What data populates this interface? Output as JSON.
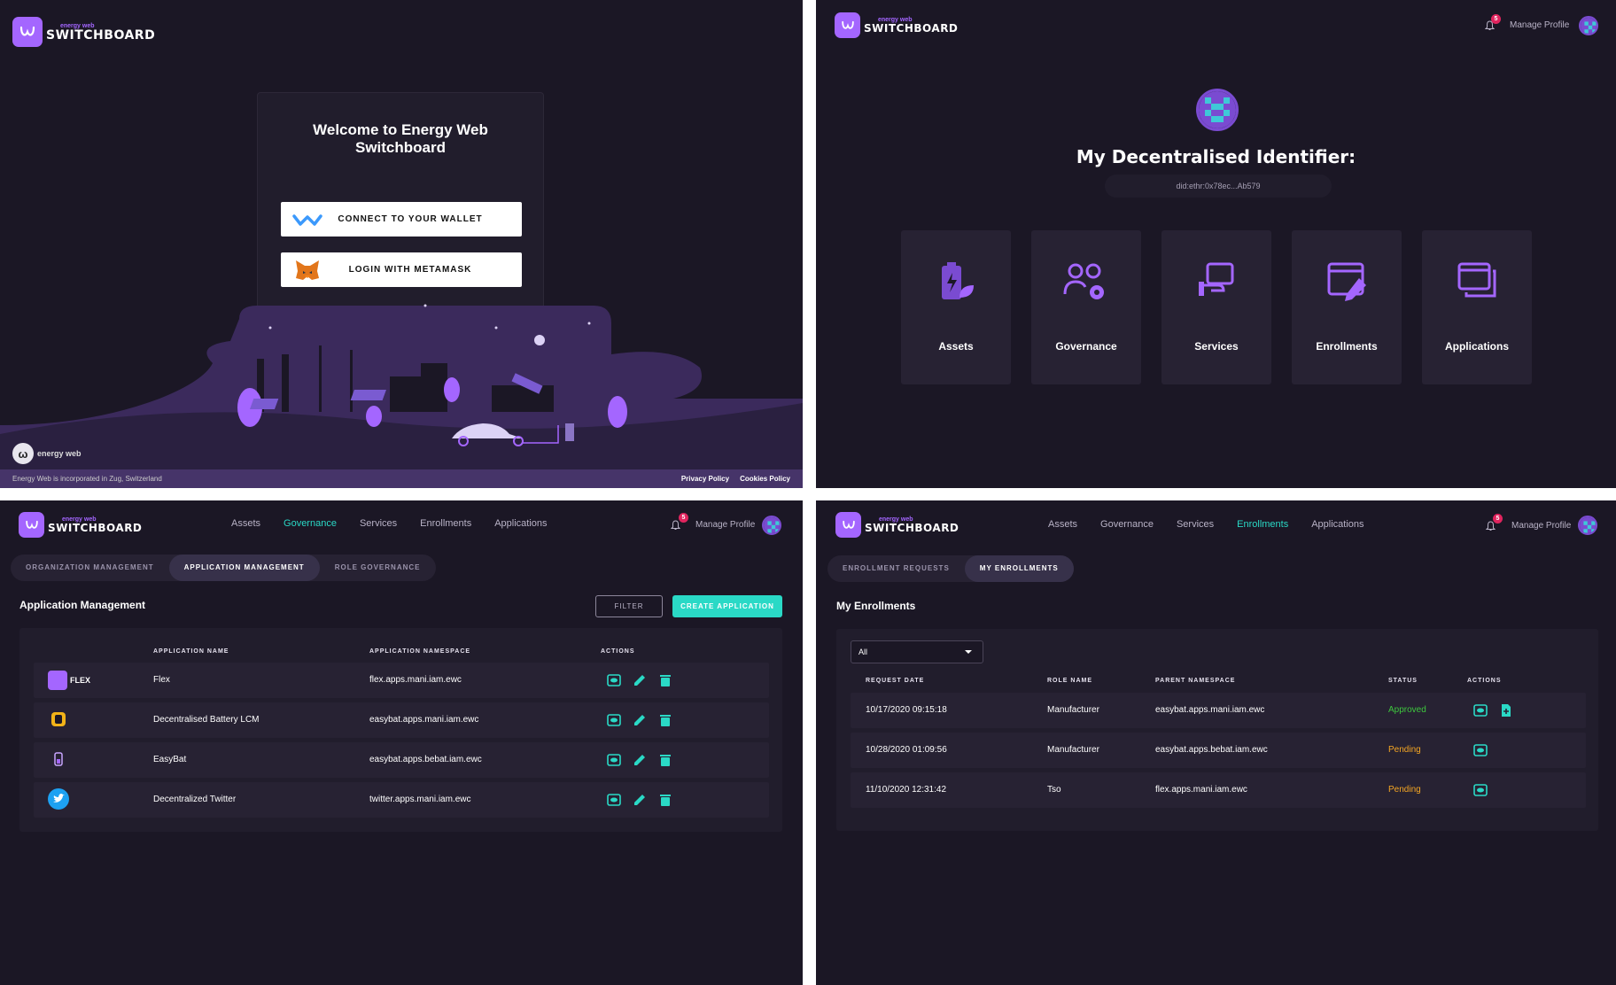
{
  "brand": {
    "small": "energy web",
    "name": "SWITCHBOARD"
  },
  "welcome": {
    "title": "Welcome to Energy Web Switchboard",
    "connect_label": "CONNECT TO YOUR WALLET",
    "metamask_label": "LOGIN WITH METAMASK",
    "energyweb_text": "energy web",
    "footer_text": "Energy Web is incorporated in Zug, Switzerland",
    "privacy": "Privacy Policy",
    "cookies": "Cookies Policy"
  },
  "header": {
    "notifications": "5",
    "manage_profile": "Manage Profile"
  },
  "dashboard": {
    "title": "My Decentralised Identifier:",
    "did": "did:ethr:0x78ec...Ab579",
    "tiles": [
      {
        "label": "Assets",
        "icon": "assets-icon"
      },
      {
        "label": "Governance",
        "icon": "governance-icon"
      },
      {
        "label": "Services",
        "icon": "services-icon"
      },
      {
        "label": "Enrollments",
        "icon": "enrollments-icon"
      },
      {
        "label": "Applications",
        "icon": "applications-icon"
      }
    ]
  },
  "nav": [
    "Assets",
    "Governance",
    "Services",
    "Enrollments",
    "Applications"
  ],
  "governance": {
    "tabs": [
      "ORGANIZATION MANAGEMENT",
      "APPLICATION MANAGEMENT",
      "ROLE GOVERNANCE"
    ],
    "title": "Application Management",
    "filter": "FILTER",
    "create": "CREATE APPLICATION",
    "columns": [
      "APPLICATION NAME",
      "APPLICATION NAMESPACE",
      "ACTIONS"
    ],
    "rows": [
      {
        "name": "Flex",
        "namespace": "flex.apps.mani.iam.ewc",
        "logo": "flex-logo",
        "logo_text": "FLEX"
      },
      {
        "name": "Decentralised Battery LCM",
        "namespace": "easybat.apps.mani.iam.ewc",
        "logo": "battery-logo"
      },
      {
        "name": "EasyBat",
        "namespace": "easybat.apps.bebat.iam.ewc",
        "logo": "easybat-logo"
      },
      {
        "name": "Decentralized Twitter",
        "namespace": "twitter.apps.mani.iam.ewc",
        "logo": "twitter-logo"
      }
    ]
  },
  "enrollments": {
    "tabs": [
      "ENROLLMENT REQUESTS",
      "MY ENROLLMENTS"
    ],
    "title": "My Enrollments",
    "filter_value": "All",
    "columns": [
      "REQUEST DATE",
      "ROLE NAME",
      "PARENT NAMESPACE",
      "STATUS",
      "ACTIONS"
    ],
    "rows": [
      {
        "date": "10/17/2020 09:15:18",
        "role": "Manufacturer",
        "namespace": "easybat.apps.mani.iam.ewc",
        "status": "Approved"
      },
      {
        "date": "10/28/2020 01:09:56",
        "role": "Manufacturer",
        "namespace": "easybat.apps.bebat.iam.ewc",
        "status": "Pending"
      },
      {
        "date": "11/10/2020 12:31:42",
        "role": "Tso",
        "namespace": "flex.apps.mani.iam.ewc",
        "status": "Pending"
      }
    ],
    "status_colors": {
      "Approved": "#3ec73e",
      "Pending": "#f5a623"
    }
  },
  "colors": {
    "accent": "#2ad9c6",
    "brand": "#a466ff",
    "bg": "#1b1725",
    "notif": "#e0245e"
  }
}
